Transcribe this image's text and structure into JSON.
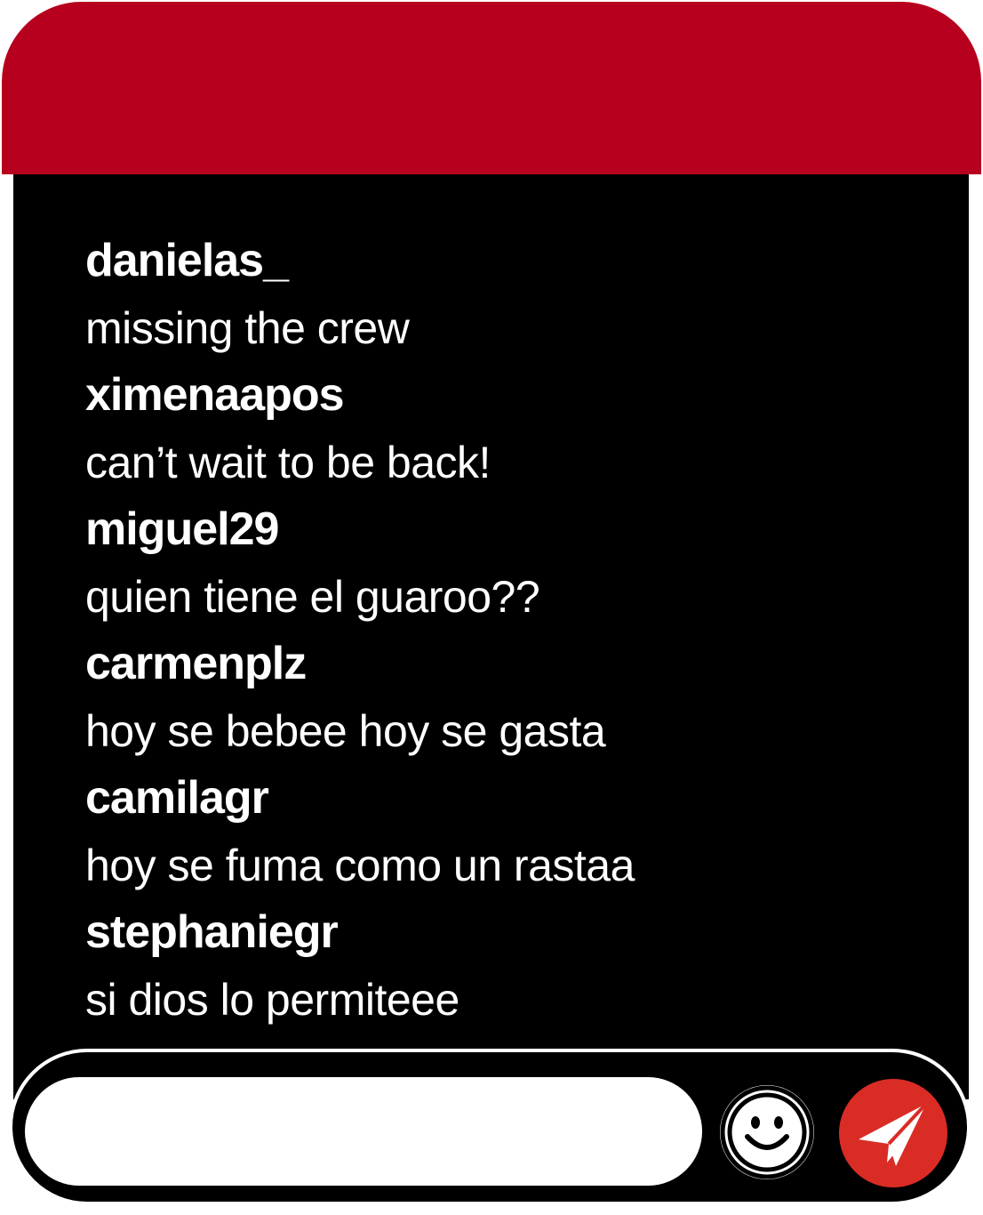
{
  "colors": {
    "header": "#b7001e",
    "chat_background": "#000000",
    "text": "#ffffff",
    "input_background": "#ffffff",
    "send_button": "#d92c25"
  },
  "messages": [
    {
      "username": "danielas_",
      "text": "missing the crew"
    },
    {
      "username": "ximenaapos",
      "text": "can’t wait to be back!"
    },
    {
      "username": "miguel29",
      "text": "quien tiene el guaroo??"
    },
    {
      "username": "carmenplz",
      "text": "hoy se bebee hoy se gasta"
    },
    {
      "username": "camilagr",
      "text": "hoy se fuma como un rastaa"
    },
    {
      "username": "stephaniegr",
      "text": "si dios lo permiteee"
    }
  ],
  "composer": {
    "input_value": "",
    "emoji_icon": "smiley-face-icon",
    "send_icon": "paper-plane-icon"
  }
}
